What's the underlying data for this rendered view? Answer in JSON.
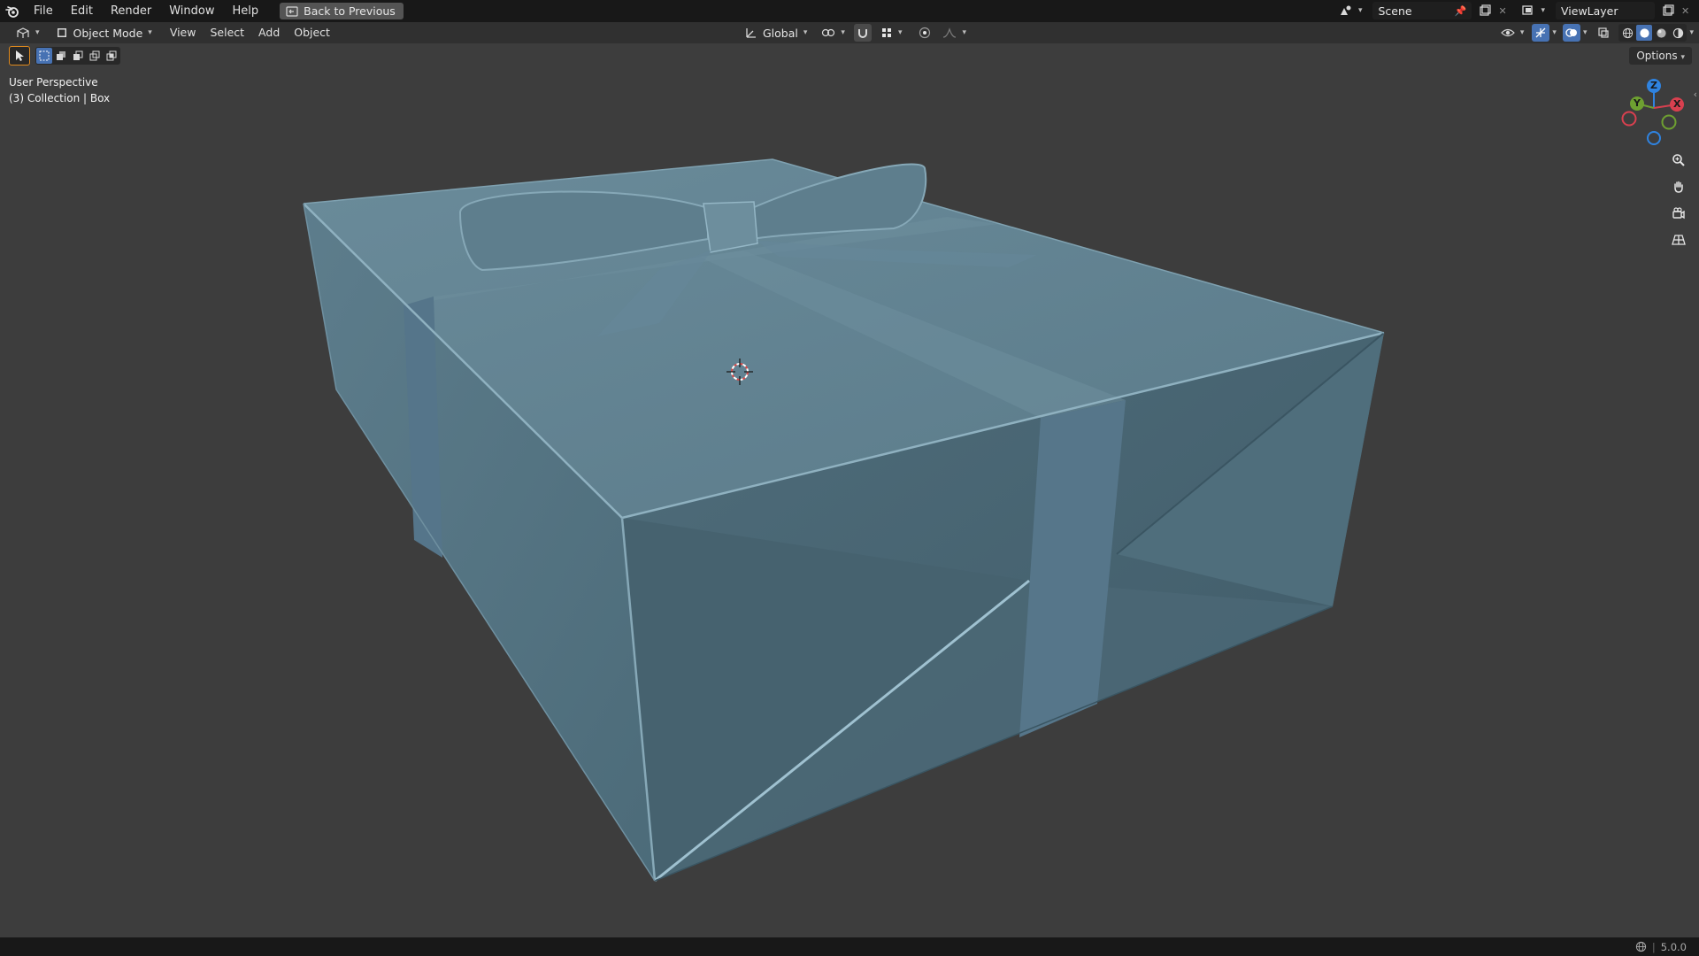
{
  "menu": {
    "items": [
      "File",
      "Edit",
      "Render",
      "Window",
      "Help"
    ],
    "back_button": "Back to Previous"
  },
  "scene": {
    "name": "Scene",
    "view_layer": "ViewLayer"
  },
  "header": {
    "mode": "Object Mode",
    "menus": [
      "View",
      "Select",
      "Add",
      "Object"
    ],
    "orientation": "Global"
  },
  "viewport": {
    "perspective": "User Perspective",
    "collection": "(3) Collection | Box",
    "options": "Options",
    "gizmo_axes": {
      "z": "Z",
      "y": "Y",
      "x": "X"
    }
  },
  "status": {
    "version": "5.0.0"
  },
  "colors": {
    "accent": "#4772b3",
    "axis_x": "#d8404f",
    "axis_y": "#6ea031",
    "axis_z": "#2f83e0",
    "box_base": "#5f7f8e"
  }
}
